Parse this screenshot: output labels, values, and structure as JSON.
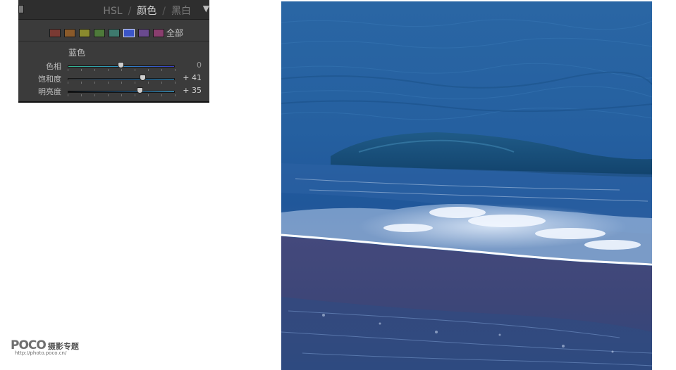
{
  "hsl_panel": {
    "tabs": [
      "HSL",
      "颜色",
      "黑白"
    ],
    "separator": "/",
    "active_tab_index": 1,
    "menu_arrow": "▼",
    "swatches": [
      {
        "name": "red",
        "color": "#7a3a33"
      },
      {
        "name": "orange",
        "color": "#8a5a2a"
      },
      {
        "name": "yellow",
        "color": "#8a8a2e"
      },
      {
        "name": "green",
        "color": "#4e7a3a"
      },
      {
        "name": "aqua",
        "color": "#3e7a6e"
      },
      {
        "name": "blue",
        "color": "#3b55c8",
        "selected": true
      },
      {
        "name": "purple",
        "color": "#6a4a8e"
      },
      {
        "name": "magenta",
        "color": "#8a3e6e"
      }
    ],
    "all_label": "全部",
    "section_title": "蓝色",
    "sliders": [
      {
        "label": "色相",
        "value_text": "0",
        "value": 0,
        "min": -100,
        "max": 100,
        "track": "hue"
      },
      {
        "label": "饱和度",
        "value_text": "+ 41",
        "value": 41,
        "min": -100,
        "max": 100,
        "track": "sat"
      },
      {
        "label": "明亮度",
        "value_text": "+ 35",
        "value": 35,
        "min": -100,
        "max": 100,
        "track": "lum"
      }
    ]
  },
  "watermark": {
    "logo": "POCO",
    "subtitle": "摄影专题",
    "url": "http://photo.poco.cn/"
  },
  "photo": {
    "subject": "ocean-wave-on-beach",
    "colors": {
      "deep_sea": "#1d4f86",
      "mid_sea": "#2a6aa6",
      "foam": "#e9f1fb",
      "sand": "#45497c"
    }
  }
}
